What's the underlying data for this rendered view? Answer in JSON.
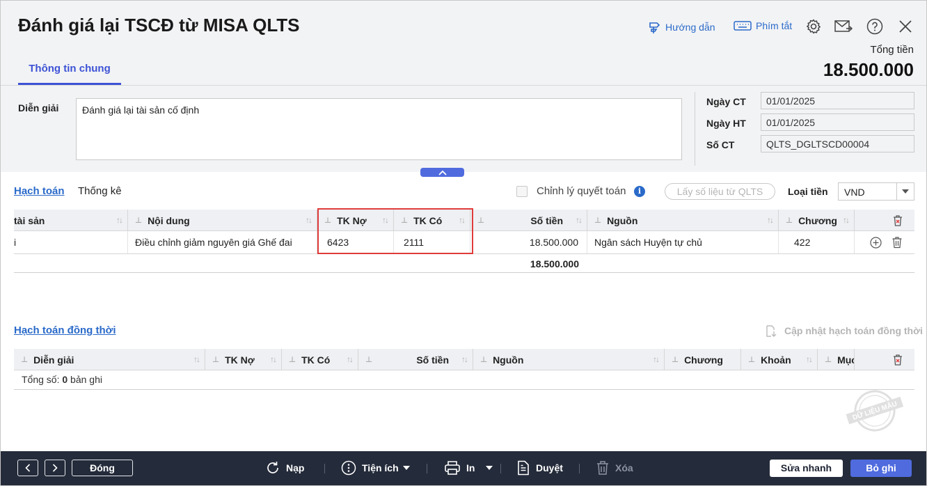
{
  "header": {
    "title": "Đánh giá lại TSCĐ từ MISA QLTS",
    "guide_label": "Hướng dẫn",
    "shortcut_label": "Phím tắt",
    "total_label": "Tổng tiền",
    "total_value": "18.500.000"
  },
  "tabs": {
    "general": "Thông tin chung"
  },
  "form": {
    "description_label": "Diễn giải",
    "description_value": "Đánh giá lại tài sản cố định",
    "doc_date_label": "Ngày CT",
    "doc_date_value": "01/01/2025",
    "post_date_label": "Ngày HT",
    "post_date_value": "01/01/2025",
    "doc_no_label": "Số CT",
    "doc_no_value": "QLTS_DGLTSCD00004"
  },
  "subtabs": {
    "accounting": "Hạch toán",
    "statistics": "Thống kê"
  },
  "options": {
    "finalize_label": "Chỉnh lý quyết toán",
    "fetch_button": "Lấy số liệu từ QLTS",
    "currency_label": "Loại tiền",
    "currency_value": "VND"
  },
  "grid1": {
    "headers": [
      "tài sản",
      "Nội dung",
      "TK Nợ",
      "TK Có",
      "Số tiền",
      "Nguồn",
      "Chương"
    ],
    "row": {
      "asset": "i",
      "content": "Điều chỉnh giảm nguyên giá Ghế đai",
      "debit": "6423",
      "credit": "2111",
      "amount": "18.500.000",
      "source": "Ngân sách Huyện tự chủ",
      "chapter": "422"
    },
    "total": "18.500.000"
  },
  "concurrent": {
    "title": "Hạch toán đồng thời",
    "update_label": "Cập nhật hạch toán đồng thời",
    "headers": [
      "Diễn giải",
      "TK Nợ",
      "TK Có",
      "Số tiền",
      "Nguồn",
      "Chương",
      "Khoản",
      "Mục"
    ],
    "summary_prefix": "Tổng số: ",
    "summary_count": "0",
    "summary_suffix": " bản ghi"
  },
  "stamp_text": "DỮ LIỆU MẪU",
  "footer": {
    "close": "Đóng",
    "reload": "Nạp",
    "utilities": "Tiện ích",
    "print": "In",
    "approve": "Duyệt",
    "delete": "Xóa",
    "quick_edit": "Sửa nhanh",
    "unpost": "Bỏ ghi"
  }
}
